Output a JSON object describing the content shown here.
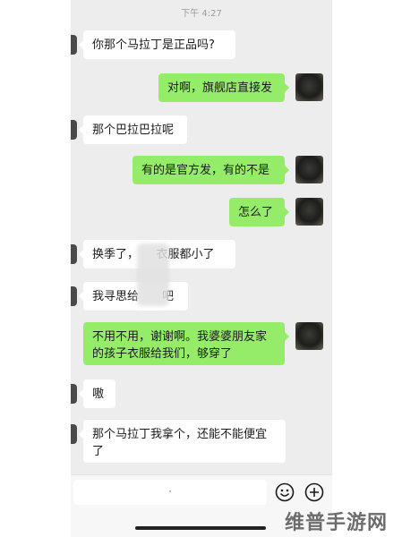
{
  "status": {
    "time": "下午 4:27"
  },
  "messages": [
    {
      "side": "left",
      "text": "你那个马拉丁是正品吗?"
    },
    {
      "side": "right",
      "text": "对啊，旗舰店直接发"
    },
    {
      "side": "left",
      "text": "那个巴拉巴拉呢"
    },
    {
      "side": "right",
      "text": "有的是官方发，有的不是"
    },
    {
      "side": "right",
      "text": "怎么了"
    },
    {
      "side": "left",
      "text": "换季了，　　衣服都小了"
    },
    {
      "side": "left",
      "text": "我寻思给　　吧"
    },
    {
      "side": "right",
      "text": "不用不用，谢谢啊。我婆婆朋友家的孩子衣服给我们，够穿了"
    },
    {
      "side": "left",
      "text": "嗷"
    },
    {
      "side": "left",
      "text": "那个马拉丁我拿个，还能不能便宜了"
    }
  ],
  "composer": {
    "placeholder": "",
    "emoji_icon": "smiley-icon",
    "plus_icon": "plus-circle-icon"
  },
  "watermark": {
    "text": "维普手游网"
  },
  "colors": {
    "sent_bubble": "#95ec69",
    "received_bubble": "#ffffff",
    "chat_bg": "#ededed"
  }
}
